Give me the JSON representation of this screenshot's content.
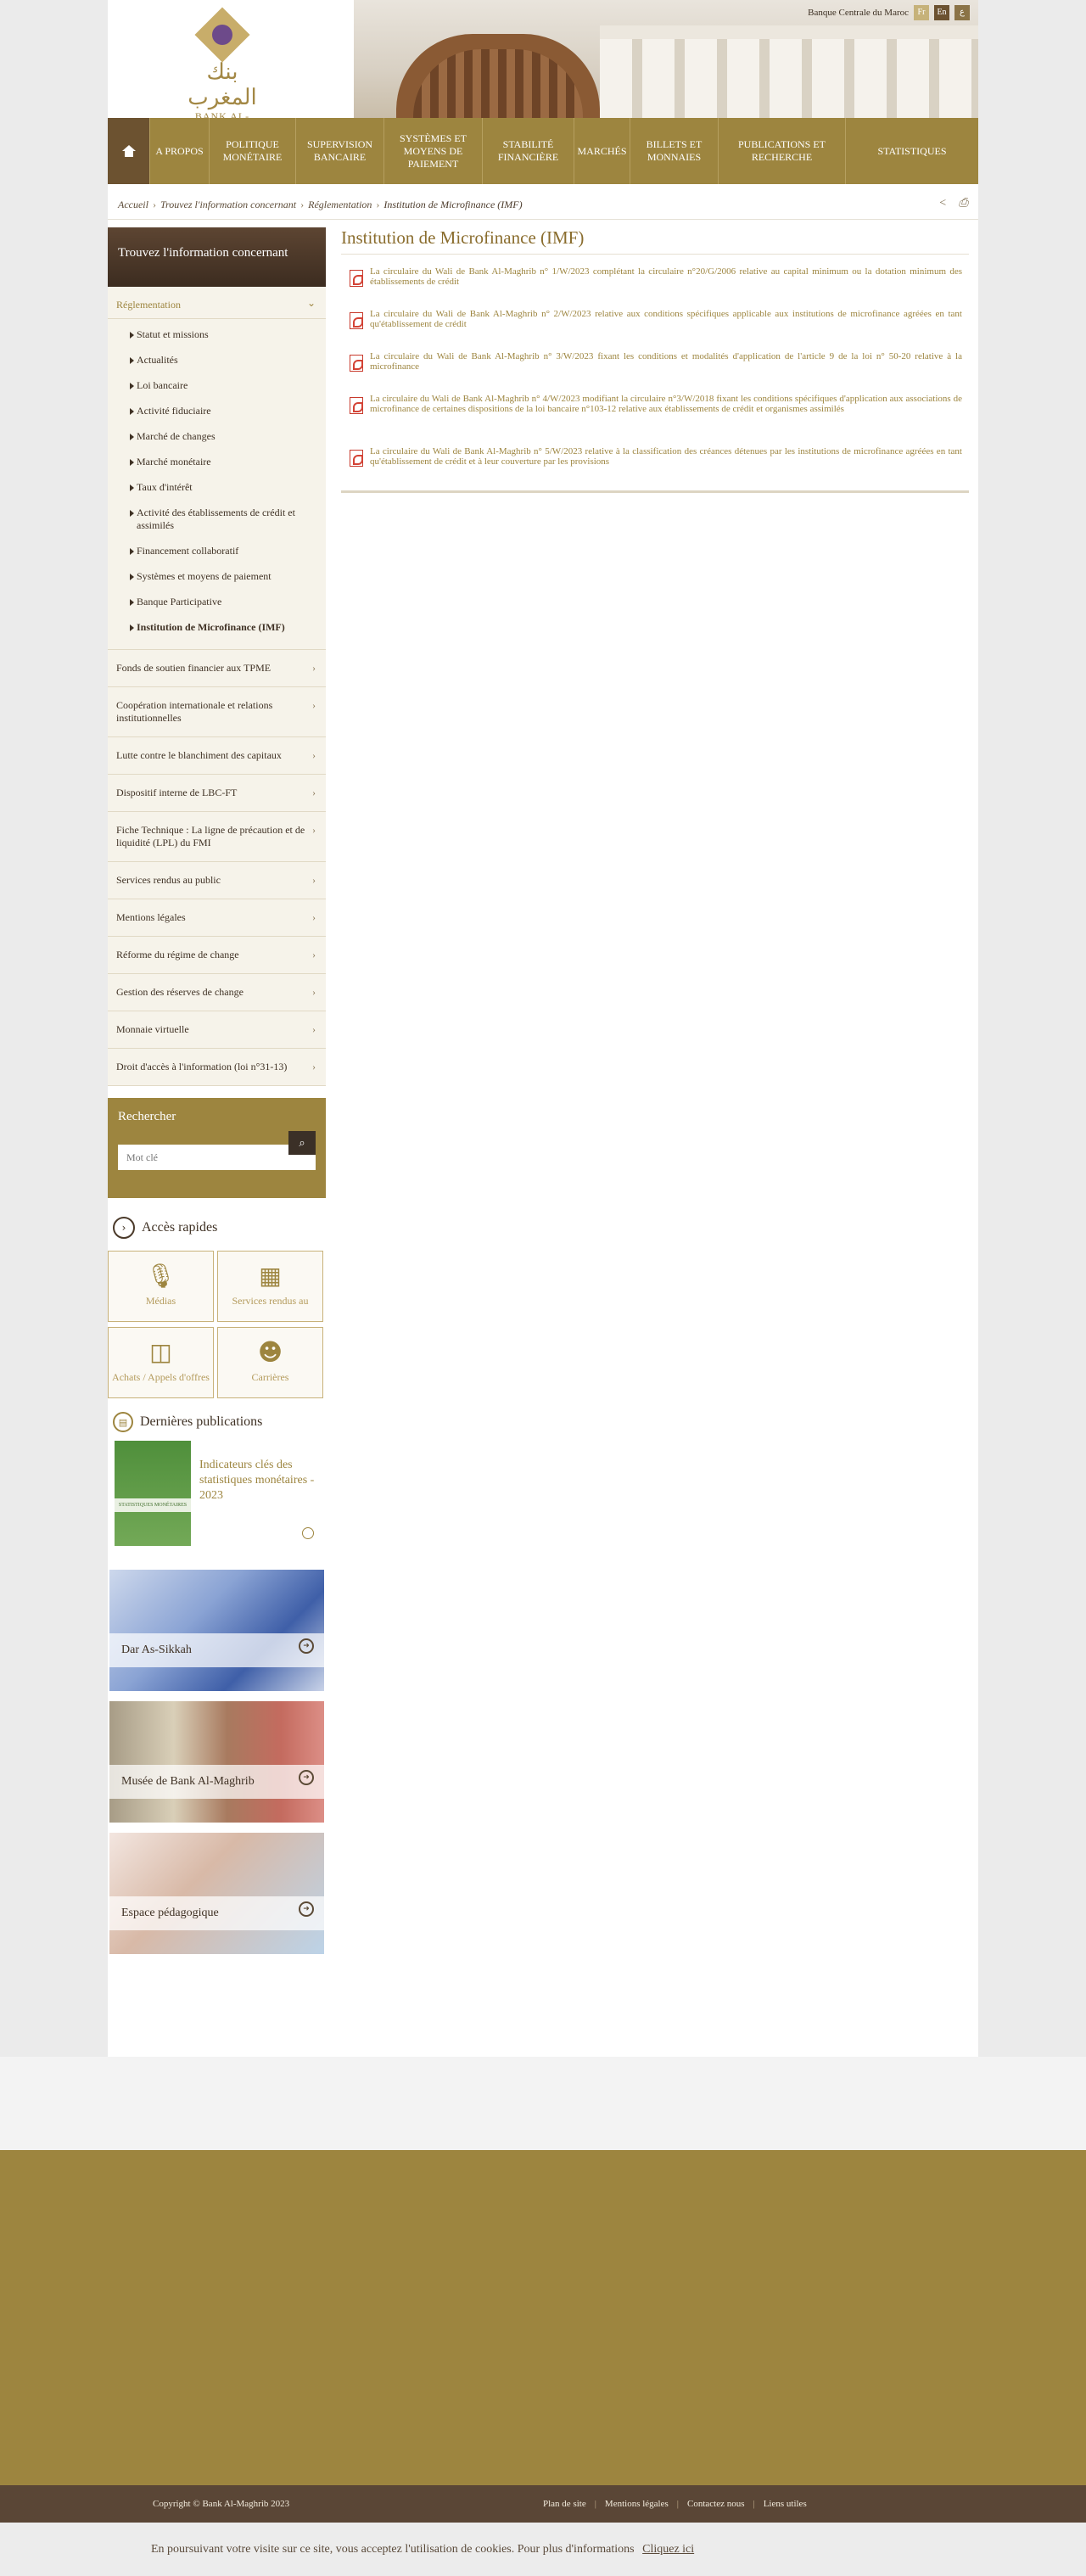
{
  "header": {
    "logo_arabic": "بنك المغرب",
    "logo_latin": "BANK AL-MAGHRIB",
    "site_name": "Banque Centrale du Maroc",
    "languages": [
      "Fr",
      "En",
      "ع"
    ]
  },
  "nav": {
    "items": [
      "A PROPOS",
      "POLITIQUE MONÉTAIRE",
      "SUPERVISION BANCAIRE",
      "SYSTÈMES ET MOYENS DE PAIEMENT",
      "STABILITÉ FINANCIÈRE",
      "MARCHÉS",
      "BILLETS ET MONNAIES",
      "PUBLICATIONS ET RECHERCHE",
      "STATISTIQUES"
    ]
  },
  "breadcrumb": {
    "items": [
      "Accueil",
      "Trouvez l'information concernant",
      "Réglementation",
      "Institution de Microfinance (IMF)"
    ]
  },
  "sidebar": {
    "title": "Trouvez l'information concernant",
    "open_item": "Réglementation",
    "submenu": [
      "Statut et missions",
      "Actualités",
      "Loi bancaire",
      "Activité fiduciaire",
      "Marché de changes",
      "Marché monétaire",
      "Taux d'intérêt",
      "Activité des établissements de crédit et assimilés",
      "Financement collaboratif",
      "Systèmes et moyens de paiement",
      "Banque Participative",
      "Institution de Microfinance (IMF)"
    ],
    "items": [
      "Fonds de soutien financier aux TPME",
      "Coopération internationale et relations institutionnelles",
      "Lutte contre le blanchiment des capitaux",
      "Dispositif interne de LBC-FT",
      "Fiche Technique : La ligne de précaution et de liquidité (LPL) du FMI",
      "Services rendus au public",
      "Mentions légales",
      "Réforme du régime de change",
      "Gestion des réserves de change",
      "Monnaie virtuelle",
      "Droit d'accès à l'information (loi n°31-13)"
    ]
  },
  "search": {
    "title": "Rechercher",
    "placeholder": "Mot clé"
  },
  "quick_access": {
    "title": "Accès rapides",
    "items": [
      {
        "label": "Médias",
        "icon": "microphone-icon"
      },
      {
        "label": "Services rendus au",
        "icon": "building-icon"
      },
      {
        "label": "Achats / Appels d'offres",
        "icon": "shopping-bag-icon"
      },
      {
        "label": "Carrières",
        "icon": "people-icon"
      }
    ]
  },
  "publications": {
    "title": "Dernières publications",
    "latest": "Indicateurs clés des statistiques monétaires - 2023",
    "cover_title": "STATISTIQUES MONÉTAIRES"
  },
  "promos": [
    "Dar As-Sikkah",
    "Musée de Bank Al-Maghrib",
    "Espace pédagogique"
  ],
  "main": {
    "title": "Institution de Microfinance (IMF)",
    "circulars": [
      "La circulaire du Wali de Bank Al-Maghrib n° 1/W/2023 complétant la circulaire n°20/G/2006 relative au capital minimum ou la dotation minimum des établissements de crédit",
      "La circulaire du Wali de Bank Al-Maghrib n° 2/W/2023 relative aux conditions spécifiques applicable aux institutions de microfinance agréées en tant qu'établissement de crédit",
      "La circulaire du Wali de Bank Al-Maghrib n° 3/W/2023 fixant les conditions et modalités d'application de l'article 9 de la loi n° 50-20 relative à la microfinance",
      "La circulaire du Wali de Bank Al-Maghrib n° 4/W/2023 modifiant la circulaire n°3/W/2018 fixant les conditions spécifiques d'application aux associations de microfinance de certaines dispositions de la loi bancaire n°103-12 relative aux établissements de crédit et organismes assimilés",
      "La circulaire du Wali de Bank Al-Maghrib n° 5/W/2023 relative à la classification des créances détenues par les institutions de microfinance agréées en tant qu'établissement de crédit et à leur couverture par les provisions"
    ]
  },
  "footer": {
    "copyright": "Copyright © Bank Al-Maghrib 2023",
    "links": [
      "Plan de site",
      "Mentions légales",
      "Contactez nous",
      "Liens utiles"
    ]
  },
  "cookie": {
    "text": "En poursuivant votre visite sur ce site, vous acceptez l'utilisation de cookies. Pour plus d'informations",
    "link": "Cliquez ici"
  }
}
